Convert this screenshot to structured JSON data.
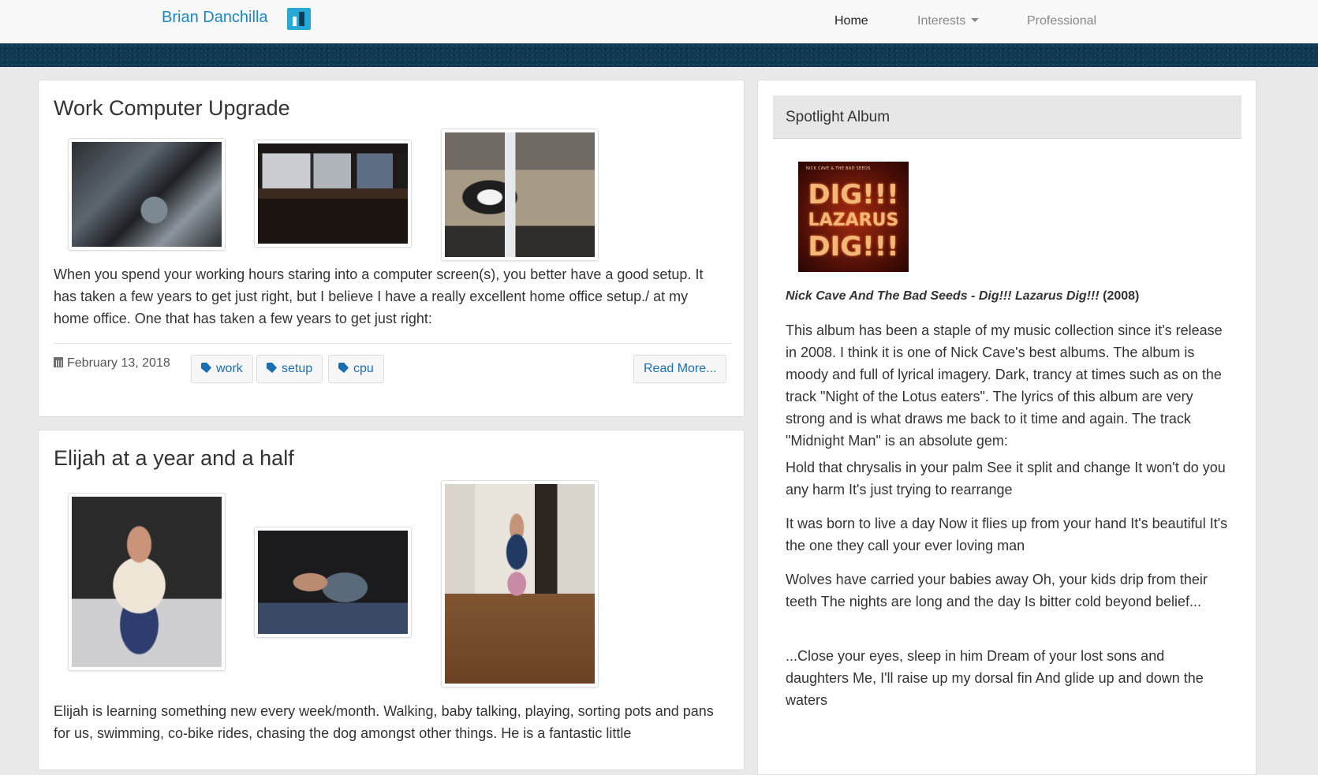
{
  "navbar": {
    "brand": "Brian Danchilla",
    "links": [
      {
        "label": "Home",
        "active": true
      },
      {
        "label": "Interests",
        "dropdown": true
      },
      {
        "label": "Professional"
      }
    ]
  },
  "posts": [
    {
      "title": "Work Computer Upgrade",
      "images": [
        "computer-internals-photo",
        "desk-monitors-photo",
        "dog-under-desk-photo"
      ],
      "text": "When you spend your working hours staring into a computer screen(s), you better have a good setup. It has taken a few years to get just right, but I believe I have a really excellent home office setup./ at my home office. One that has taken a few years to get just right:",
      "date": "February 13, 2018",
      "tags": [
        "work",
        "setup",
        "cpu"
      ],
      "read_more": "Read More..."
    },
    {
      "title": "Elijah at a year and a half",
      "images": [
        "toddler-sitting-photo",
        "toddler-sleeping-photo",
        "toddler-walking-photo"
      ],
      "text": "Elijah is learning something new every week/month. Walking, baby talking, playing, sorting pots and pans for us, swimming, co-bike rides, chasing the dog amongst other things. He is a fantastic little"
    }
  ],
  "sidebar": {
    "heading": "Spotlight Album",
    "album": {
      "cover_small_text": "NICK CAVE & THE BAD SEEDS",
      "cover_line1": "DIG!!!",
      "cover_line2": "LAZARUS",
      "cover_line3": "DIG!!!",
      "caption_title": "Nick Cave And The Bad Seeds - Dig!!! Lazarus Dig!!!",
      "caption_year": " (2008)"
    },
    "paragraphs": [
      "This album has been a staple of my music collection since it's release in 2008. I think it is one of Nick Cave's best albums. The album is moody and full of lyrical imagery. Dark, trancy at times such as on the track \"Night of the Lotus eaters\". The lyrics of this album are very strong and is what draws me back to it time and again. The track \"Midnight Man\" is an absolute gem:",
      "Hold that chrysalis in your palm See it split and change It won't do you any harm It's just trying to rearrange",
      "It was born to live a day Now it flies up from your hand It's beautiful It's the one they call your ever loving man",
      "Wolves have carried your babies away Oh, your kids drip from their teeth The nights are long and the day Is bitter cold beyond belief...",
      "...Close your eyes, sleep in him Dream of your lost sons and daughters Me, I'll raise up my dorsal fin And glide up and down the waters"
    ]
  },
  "colors": {
    "brand": "#1a87c4",
    "link": "#1a6fb3",
    "banner": "#0f3a52"
  }
}
